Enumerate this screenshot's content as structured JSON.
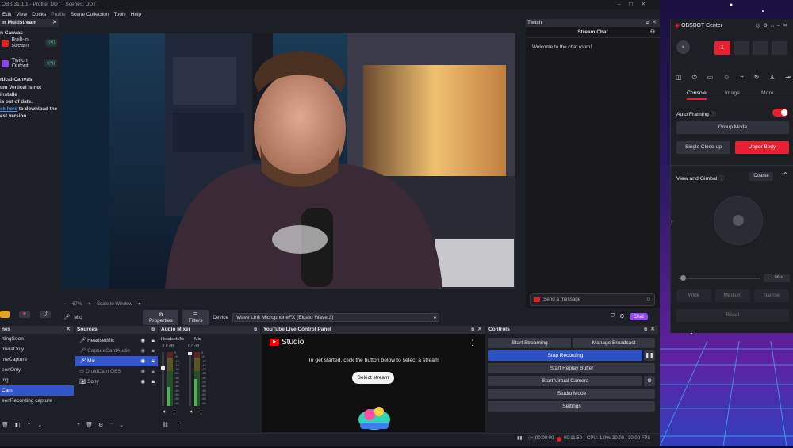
{
  "obs": {
    "title": "OBS 31.1.1 - Profile: DDT - Scenes: DDT",
    "menu": [
      "Edit",
      "View",
      "Docks",
      "Profile",
      "Scene Collection",
      "Tools",
      "Help"
    ],
    "multistream": {
      "title": "m Multistream",
      "canvas_label": "n Canvas",
      "items": [
        "Built-in stream",
        "Twitch Output"
      ],
      "vertical_title": "rtical Canvas",
      "warning_lines": [
        "um Vertical is not installe",
        "is out of date."
      ],
      "link_text": "ck here",
      "link_after": " to download the",
      "warning_end": "est version."
    },
    "preview": {
      "zoom": "67%",
      "scale": "Scale to Window"
    },
    "twitch": {
      "panel_title": "Twitch",
      "chat_title": "Stream Chat",
      "welcome": "Welcome to the chat room!",
      "send_placeholder": "Send a message",
      "chat_button": "Chat"
    },
    "source_toolbar": {
      "source": "Mic",
      "properties": "Properties",
      "filters": "Filters",
      "device_label": "Device",
      "device_value": "Wave Link MicrophoneFX (Elgato Wave:3)"
    },
    "scenes": {
      "title": "nes",
      "items": [
        "rtingSoon",
        "meraOnly",
        "meCapture",
        "eenOnly",
        "ing",
        "Cam",
        "eenRecording capture"
      ],
      "selected_index": 5
    },
    "sources": {
      "title": "Sources",
      "items": [
        "HeadsetMic",
        "CaptureCardAudio",
        "Mic",
        "DroidCam OBS",
        "Sony"
      ],
      "selected_index": 2
    },
    "mixer": {
      "title": "Audio Mixer",
      "channels": [
        {
          "name": "HeadsetMic",
          "db": "-8.8 dB",
          "level": 0.35
        },
        {
          "name": "Mic",
          "db": "0.0 dB",
          "level": 0.5
        }
      ],
      "scale": [
        "0",
        "-5",
        "-10",
        "-15",
        "-20",
        "-25",
        "-30",
        "-35",
        "-40",
        "-45",
        "-50",
        "-55",
        "-60"
      ]
    },
    "youtube": {
      "title": "YouTube Live Control Panel",
      "logo": "Studio",
      "message": "To get started, click the button below to select a stream",
      "button": "Select stream"
    },
    "controls": {
      "title": "Controls",
      "start_streaming": "Start Streaming",
      "manage_broadcast": "Manage Broadcast",
      "stop_recording": "Stop Recording",
      "replay": "Start Replay Buffer",
      "virtual_cam": "Start Virtual Camera",
      "studio_mode": "Studio Mode",
      "settings": "Settings"
    },
    "status": {
      "stream_time": "00:00:00",
      "rec_time": "00:11:50",
      "cpu": "CPU: 1.0%",
      "fps": "30.00 / 30.00 FPS"
    }
  },
  "obsbot": {
    "title": "OBSBOT Center",
    "device_slots": [
      "1",
      "",
      "",
      ""
    ],
    "tabs": [
      "Console",
      "Image",
      "More"
    ],
    "active_tab": "Console",
    "auto_framing": "Auto Framing",
    "auto_framing_on": true,
    "group_mode": "Group Mode",
    "single_closeup": "Single Close-up",
    "upper_body": "Upper Body",
    "view_gimbal": "View and Gimbal",
    "coarse": "Coarse",
    "zoom_value": "1.06 x",
    "zoom_level": 0.02,
    "fov": [
      "Wide",
      "Medium",
      "Narrow"
    ],
    "reset": "Reset",
    "accent": "#e8202f"
  }
}
